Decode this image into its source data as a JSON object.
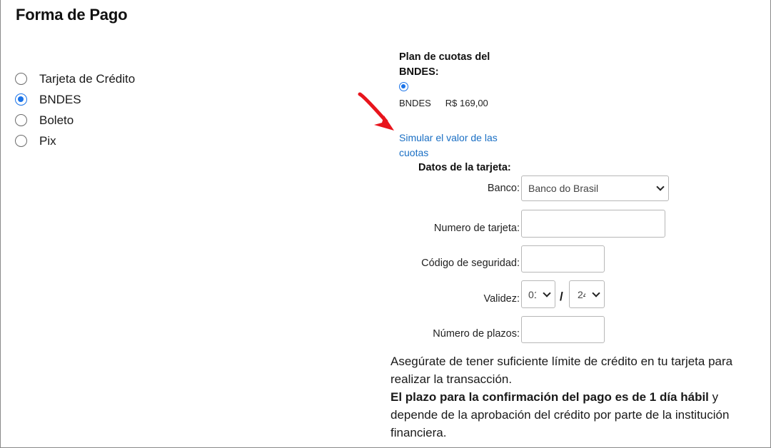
{
  "page": {
    "title": "Forma de Pago"
  },
  "payment_methods": [
    {
      "label": "Tarjeta de Crédito",
      "selected": false
    },
    {
      "label": "BNDES",
      "selected": true
    },
    {
      "label": "Boleto",
      "selected": false
    },
    {
      "label": "Pix",
      "selected": false
    }
  ],
  "plan": {
    "title": "Plan de cuotas del BNDES:",
    "option_name": "BNDES",
    "option_price": "R$ 169,00",
    "simulate_link": "Simular el valor de las cuotas"
  },
  "card_form": {
    "title": "Datos de la tarjeta:",
    "bank_label": "Banco:",
    "bank_value": "Banco do Brasil",
    "number_label": "Numero de tarjeta:",
    "number_value": "",
    "cvv_label": "Código de seguridad:",
    "cvv_value": "",
    "validity_label": "Validez:",
    "validity_month": "01",
    "validity_separator": "/",
    "validity_year": "24",
    "installments_label": "Número de plazos:",
    "installments_value": ""
  },
  "notice": {
    "line1": "Asegúrate de tener suficiente límite de crédito en tu tarjeta para realizar la transacción.",
    "bold": "El plazo para la confirmación del pago es de 1 día hábil",
    "rest": " y depende de la aprobación del crédito por parte de la institución financiera."
  },
  "colors": {
    "accent": "#1a73e8",
    "link": "#1a6fc4",
    "annotation_arrow": "#e8141c"
  },
  "icons": {
    "annotation": "red-arrow-icon",
    "select_chevron": "chevron-down-icon"
  }
}
